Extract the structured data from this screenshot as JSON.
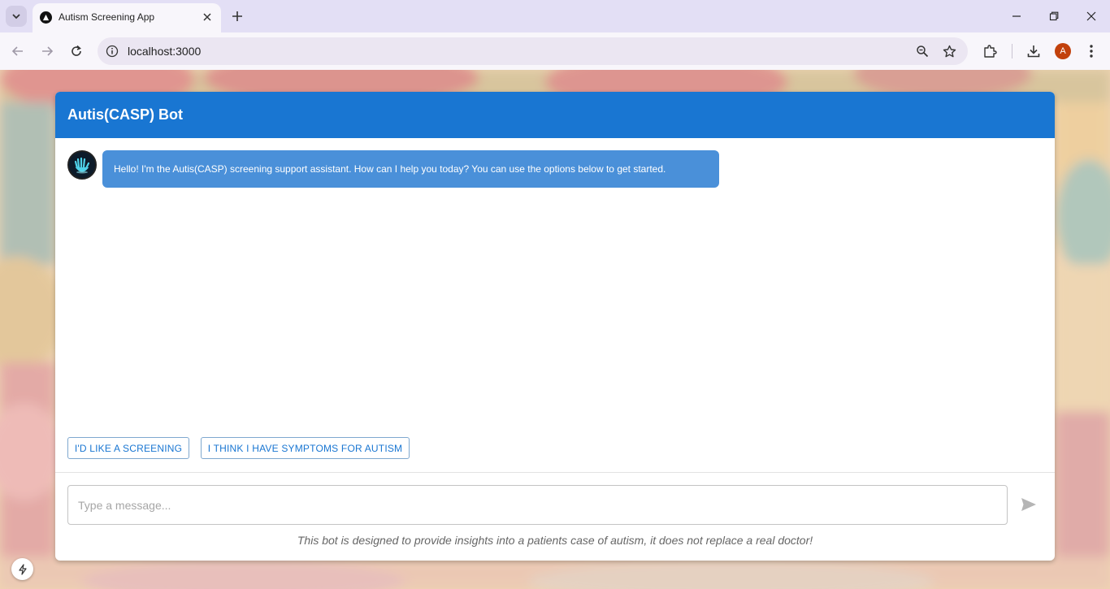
{
  "browser": {
    "tab_title": "Autism Screening App",
    "url": "localhost:3000",
    "profile_initial": "A"
  },
  "chat": {
    "title": "Autis(CASP) Bot",
    "bot_message": "Hello! I'm the Autis(CASP) screening support assistant. How can I help you today? You can use the options below to get started.",
    "options": [
      "I'D LIKE A SCREENING",
      "I THINK I HAVE SYMPTOMS FOR AUTISM"
    ],
    "input_placeholder": "Type a message...",
    "disclaimer": "This bot is designed to provide insights into a patients case of autism, it does not replace a real doctor!"
  },
  "colors": {
    "header": "#1976d2",
    "bubble": "#4a90d9",
    "tab_strip": "#e3dff5"
  }
}
